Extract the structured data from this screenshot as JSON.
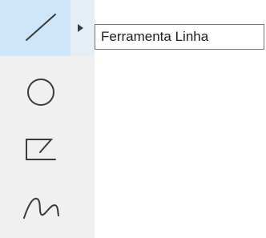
{
  "toolbar": {
    "tools": [
      {
        "icon": "line-icon",
        "active": true
      },
      {
        "icon": "circle-icon",
        "active": false
      },
      {
        "icon": "polygon-icon",
        "active": false
      },
      {
        "icon": "freehand-icon",
        "active": false
      }
    ]
  },
  "tooltip": {
    "text": "Ferramenta Linha"
  },
  "colors": {
    "toolbar_bg": "#f0f0f0",
    "active_bg": "#cfe6f8",
    "icon_stroke": "#3a3a3a",
    "tooltip_border": "#767676"
  }
}
